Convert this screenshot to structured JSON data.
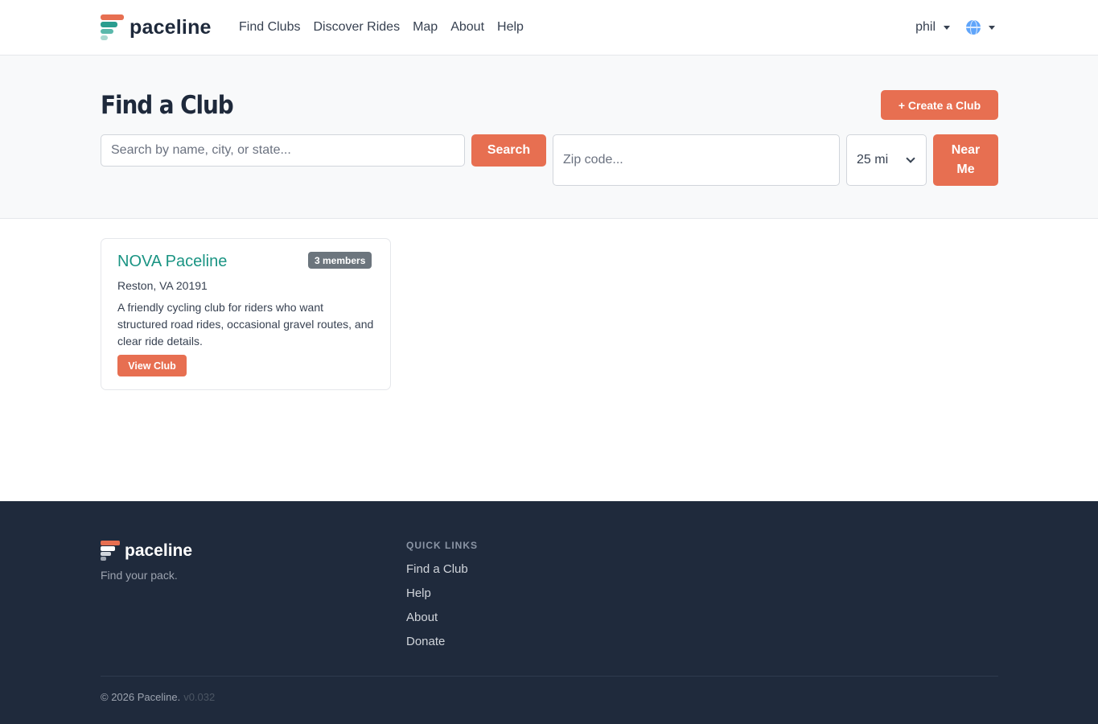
{
  "colors": {
    "accent": "#e76f51",
    "teal": "#2a9d8f",
    "footer_bg": "#1f2a3c"
  },
  "navbar": {
    "brand": "paceline",
    "links": [
      "Find Clubs",
      "Discover Rides",
      "Map",
      "About",
      "Help"
    ],
    "user": "phil",
    "language_icon": "globe-icon"
  },
  "hero": {
    "title": "Find a Club",
    "create_button": "+ Create a Club",
    "search_placeholder": "Search by name, city, or state...",
    "search_button": "Search",
    "zip_placeholder": "Zip code...",
    "radius_selected": "25 mi",
    "near_me_button": "Near Me"
  },
  "clubs": [
    {
      "name": "NOVA Paceline",
      "members": "3 members",
      "location": "Reston, VA 20191",
      "description": "A friendly cycling club for riders who want structured road rides, occasional gravel routes, and clear ride details.",
      "button": "View Club"
    }
  ],
  "footer": {
    "brand": "paceline",
    "tagline": "Find your pack.",
    "quick_links_heading": "QUICK LINKS",
    "quick_links": [
      "Find a Club",
      "Help",
      "About",
      "Donate"
    ],
    "copyright": "© 2026 Paceline.",
    "version": "v0.032"
  }
}
